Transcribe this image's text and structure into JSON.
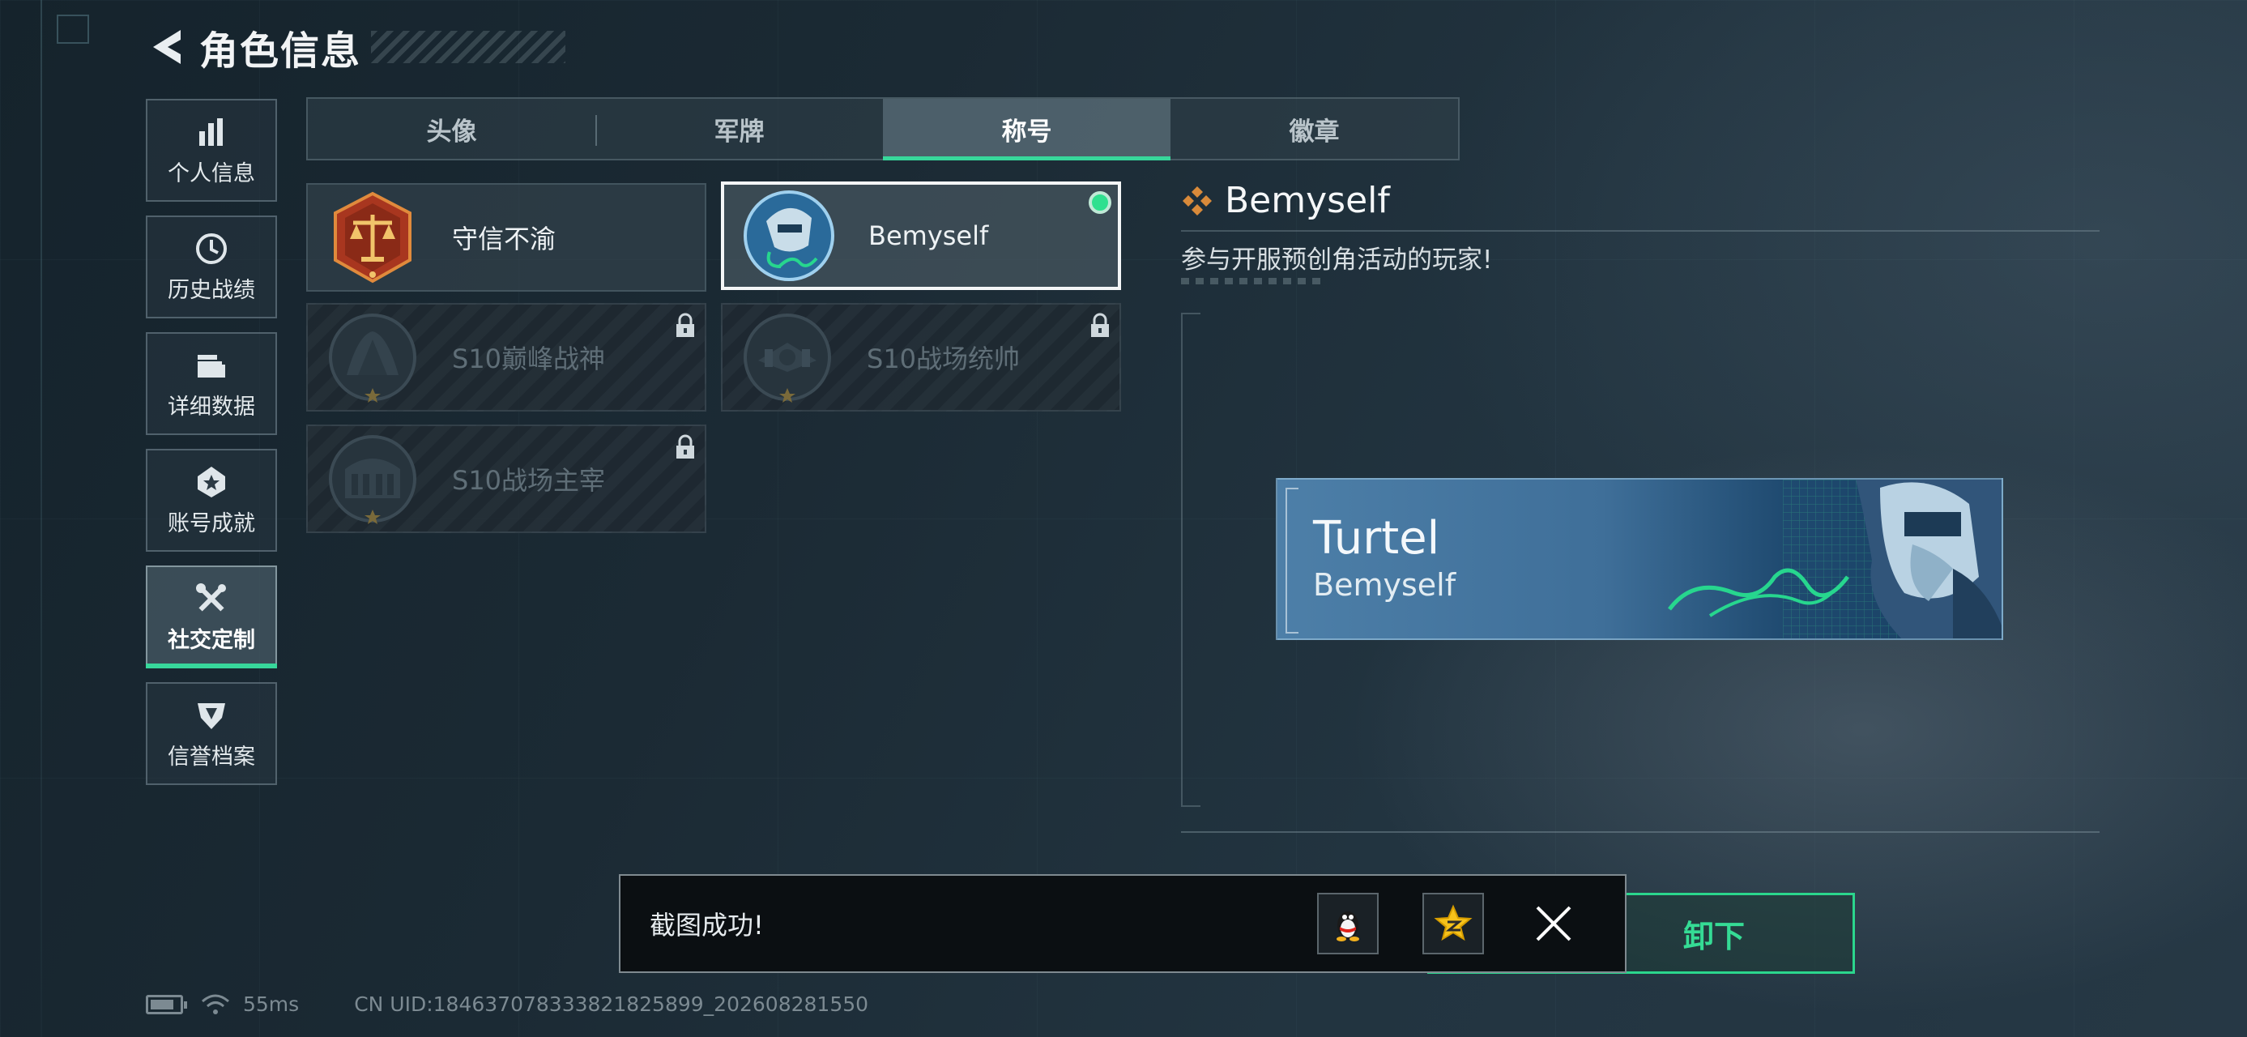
{
  "header": {
    "title": "角色信息"
  },
  "nav": {
    "items": [
      {
        "label": "个人信息",
        "icon": "bar-chart-icon"
      },
      {
        "label": "历史战绩",
        "icon": "history-clock-icon"
      },
      {
        "label": "详细数据",
        "icon": "data-folder-icon"
      },
      {
        "label": "账号成就",
        "icon": "achievement-badge-icon"
      },
      {
        "label": "社交定制",
        "icon": "tools-icon",
        "active": true
      },
      {
        "label": "信誉档案",
        "icon": "credit-shield-icon"
      }
    ]
  },
  "tabs": [
    {
      "label": "头像"
    },
    {
      "label": "军牌"
    },
    {
      "label": "称号",
      "active": true
    },
    {
      "label": "徽章"
    }
  ],
  "titles": [
    {
      "label": "守信不渝",
      "emblem": "justice-scales-emblem",
      "locked": false,
      "selected": false
    },
    {
      "label": "Bemyself",
      "emblem": "soldier-signature-emblem",
      "locked": false,
      "selected": true,
      "equipped": true
    },
    {
      "label": "S10巅峰战神",
      "emblem": "s10-peak-emblem",
      "locked": true
    },
    {
      "label": "S10战场统帅",
      "emblem": "s10-commander-emblem",
      "locked": true
    },
    {
      "label": "S10战场主宰",
      "emblem": "s10-dominator-emblem",
      "locked": true
    }
  ],
  "detail": {
    "name": "Bemyself",
    "description": "参与开服预创角活动的玩家!",
    "banner": {
      "player_name": "Turtel",
      "title": "Bemyself"
    },
    "action_label": "卸下"
  },
  "toast": {
    "text": "截图成功!",
    "share_icons": [
      "qq-penguin-icon",
      "qzone-star-icon"
    ]
  },
  "status": {
    "ping": "55ms",
    "uid": "CN UID:1846370783338218258​99_202608281550"
  },
  "colors": {
    "accent": "#37d79b",
    "locked_text": "#5f6e77",
    "background": "#1b2a34"
  }
}
